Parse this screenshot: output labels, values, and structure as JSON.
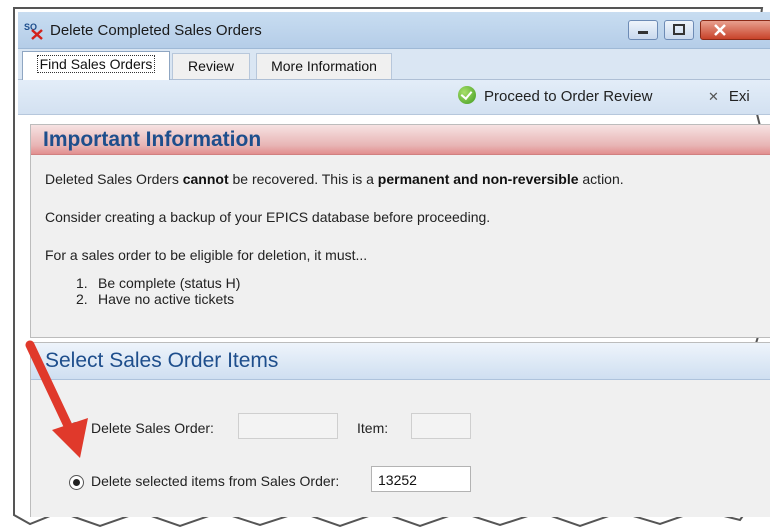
{
  "window": {
    "app_icon_text": "SO",
    "title": "Delete Completed Sales Orders"
  },
  "tabs": [
    {
      "label": "Find Sales Orders",
      "active": true
    },
    {
      "label": "Review",
      "active": false
    },
    {
      "label": "More Information",
      "active": false
    }
  ],
  "toolbar": {
    "proceed_label": "Proceed to Order Review",
    "exit_label": "Exi"
  },
  "info_panel": {
    "heading": "Important Information",
    "line1_pre": "Deleted Sales Orders ",
    "line1_bold1": "cannot",
    "line1_mid": " be recovered. This is a ",
    "line1_bold2": "permanent and non-reversible",
    "line1_post": " action.",
    "line2": "Consider creating a backup of your EPICS database before proceeding.",
    "line3": "For a sales order to be eligible for deletion, it must...",
    "conditions": [
      {
        "num": "1.",
        "text": "Be complete (status H)"
      },
      {
        "num": "2.",
        "text": "Have no active tickets"
      }
    ]
  },
  "select_panel": {
    "heading": "Select Sales Order Items",
    "option1_label": "Delete Sales Order:",
    "option1_value": "",
    "item_label": "Item:",
    "item_value": "",
    "option2_label": "Delete selected items from Sales Order:",
    "option2_value": "13252",
    "selected_option": "option2"
  },
  "colors": {
    "info_heading": "#1e4e8c",
    "annotation_arrow": "#e0392b"
  }
}
